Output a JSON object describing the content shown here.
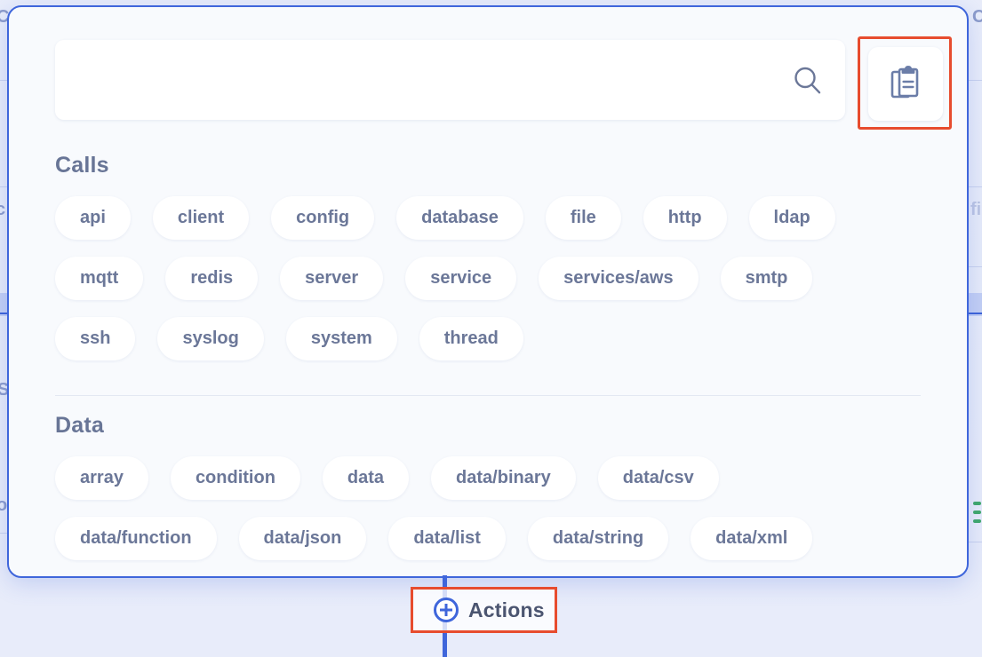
{
  "modal": {
    "search": {
      "value": "",
      "placeholder": "",
      "search_icon": "search-icon",
      "paste_button": {
        "icon": "clipboard-paste-icon",
        "label": ""
      }
    },
    "sections": [
      {
        "title": "Calls",
        "rows": [
          [
            "api",
            "client",
            "config",
            "database",
            "file",
            "http",
            "ldap"
          ],
          [
            "mqtt",
            "redis",
            "server",
            "service",
            "services/aws",
            "smtp"
          ],
          [
            "ssh",
            "syslog",
            "system",
            "thread"
          ]
        ]
      },
      {
        "title": "Data",
        "rows": [
          [
            "array",
            "condition",
            "data",
            "data/binary",
            "data/csv"
          ],
          [
            "data/function",
            "data/json",
            "data/list",
            "data/string",
            "data/xml"
          ]
        ]
      }
    ]
  },
  "node": {
    "actions_label": "Actions",
    "plus_icon": "plus-circle-icon"
  },
  "background": {
    "fragments": [
      "C",
      "c",
      "S",
      "o",
      "C",
      "fil"
    ]
  },
  "colors": {
    "accent_blue": "#3f66db",
    "highlight_red": "#e74c2e",
    "tag_text": "#6b7798",
    "section_title": "#687596",
    "modal_bg": "#f8fafd",
    "page_bg": "#e8ecfa"
  }
}
